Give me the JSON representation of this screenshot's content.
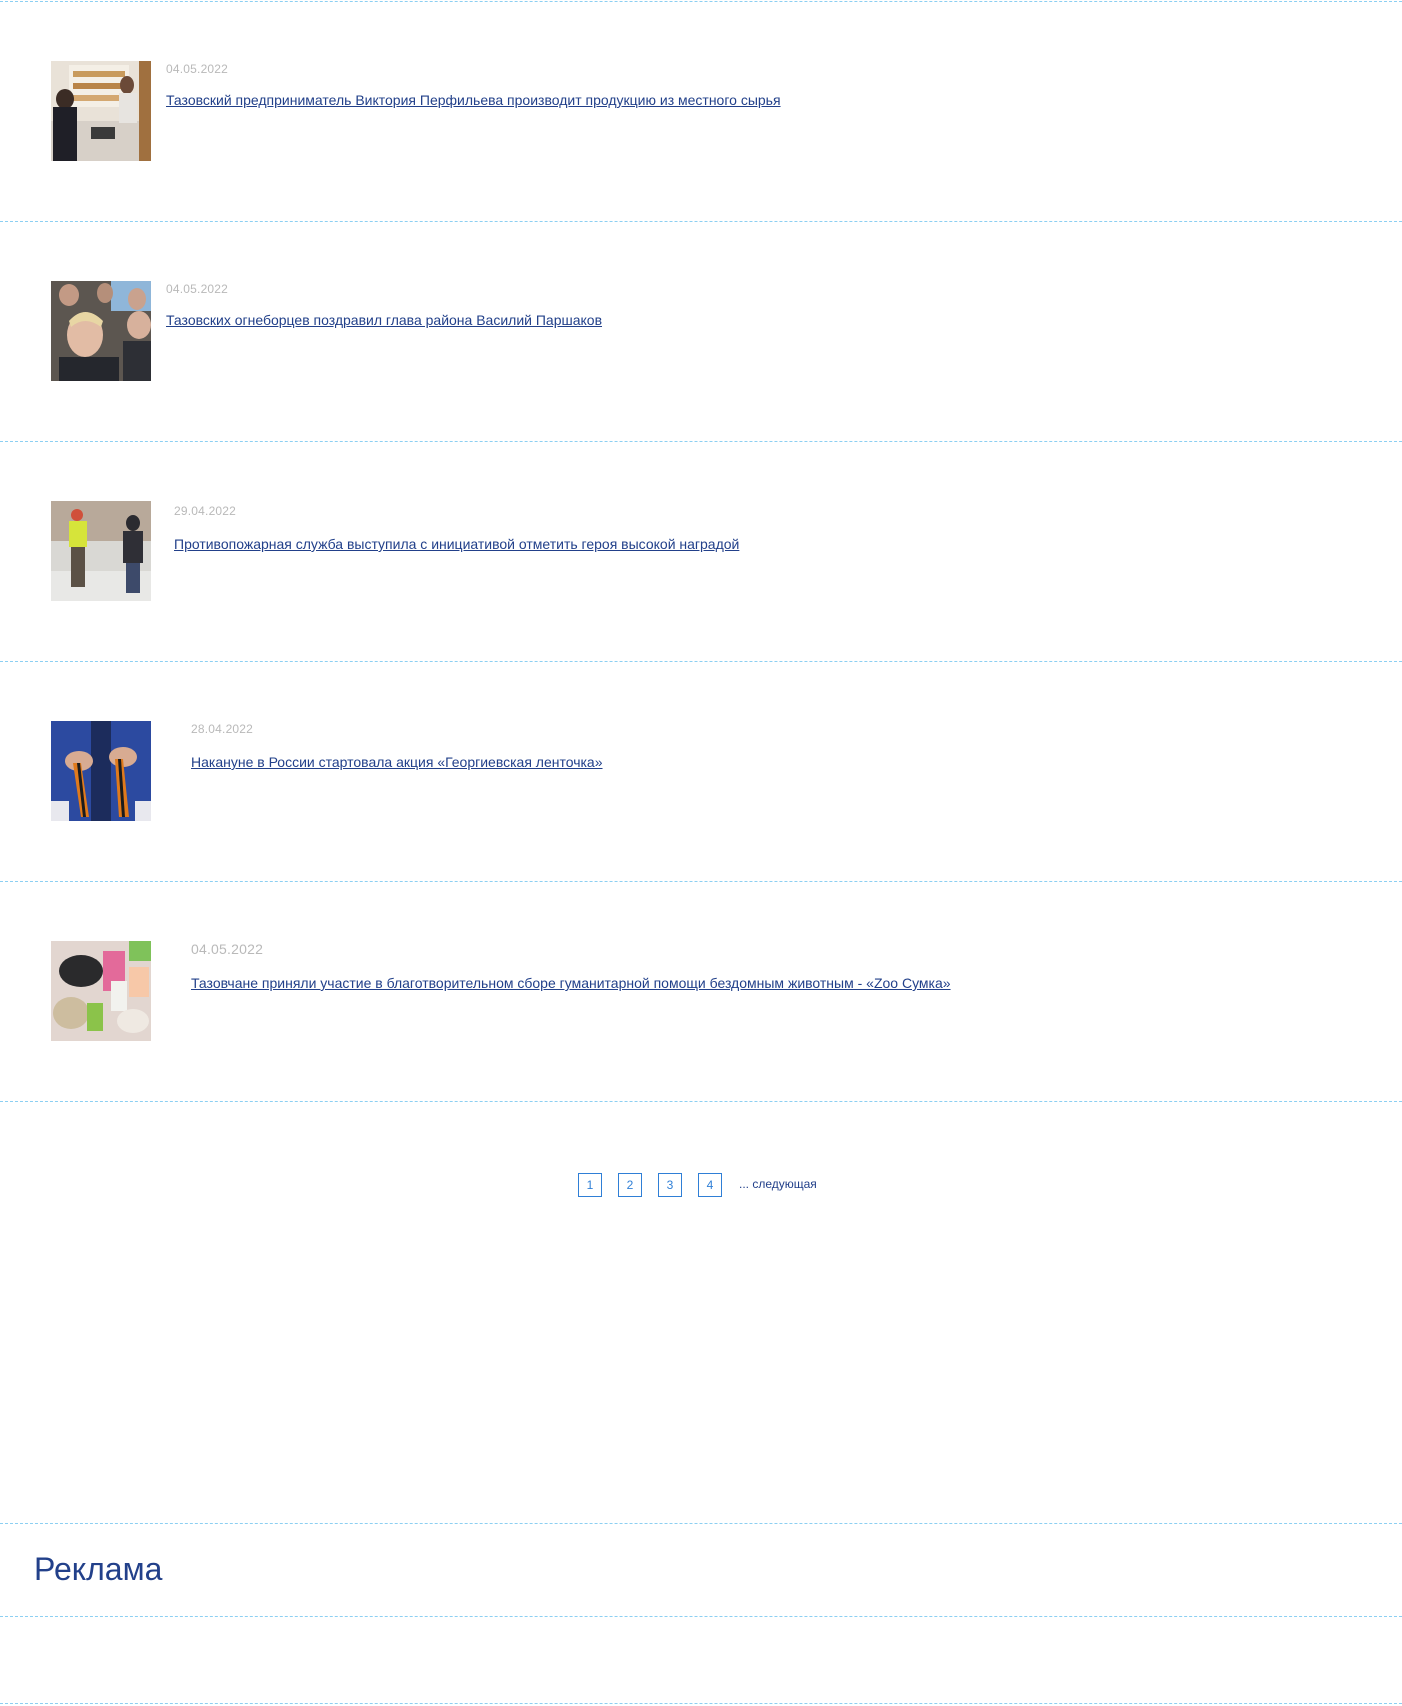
{
  "news": [
    {
      "date": "04.05.2022",
      "title": "Тазовский предприниматель Виктория Перфильева производит продукцию из местного сырья",
      "thumb_icon": "bakery-photo"
    },
    {
      "date": "04.05.2022",
      "title": "Тазовских огнеборцев поздравил глава района Василий Паршаков",
      "thumb_icon": "firefighters-photo"
    },
    {
      "date": "29.04.2022",
      "title": "Противопожарная служба выступила с инициативой отметить героя высокой наградой",
      "thumb_icon": "people-outdoor-photo"
    },
    {
      "date": "28.04.2022",
      "title": "Накануне в России стартовала акция «Георгиевская ленточка»",
      "thumb_icon": "ribbons-photo"
    },
    {
      "date": "04.05.2022",
      "title": "Тазовчане приняли участие в благотворительном сборе гуманитарной помощи бездомным животным - «Zoo Сумка»",
      "thumb_icon": "donations-photo"
    }
  ],
  "pagination": {
    "pages": [
      "1",
      "2",
      "3",
      "4"
    ],
    "next_label": "... следующая"
  },
  "ads": {
    "heading": "Реклама"
  },
  "colors": {
    "divider": "#8ccff2",
    "link": "#22408a",
    "date": "#b9b9b9",
    "page_border": "#2f7fd6"
  }
}
